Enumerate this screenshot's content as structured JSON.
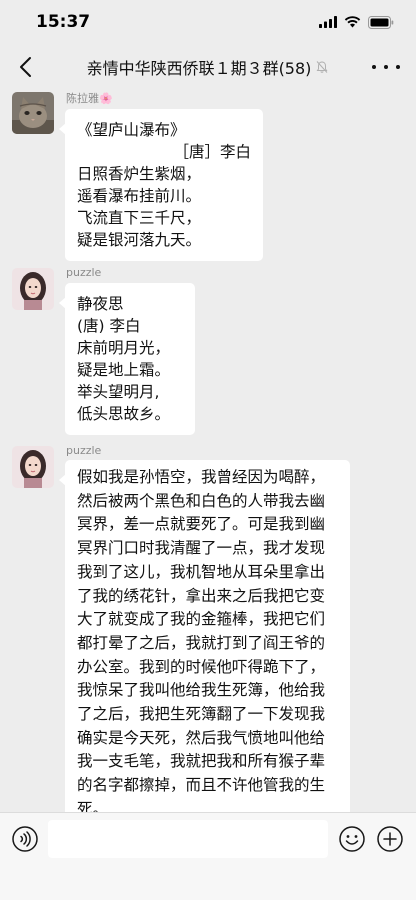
{
  "status_bar": {
    "time": "15:37"
  },
  "header": {
    "title": "亲情中华陕西侨联１期３群(58)"
  },
  "messages": [
    {
      "sender": "陈拉雅🌸",
      "lines": [
        "《望庐山瀑布》",
        "［唐］李白",
        "日照香炉生紫烟，",
        "遥看瀑布挂前川。",
        "飞流直下三千尺，",
        "疑是银河落九天。"
      ]
    },
    {
      "sender": "puzzle",
      "lines": [
        "静夜思",
        "(唐) 李白",
        "床前明月光，",
        "疑是地上霜。",
        "举头望明月,",
        "低头思故乡。"
      ]
    },
    {
      "sender": "puzzle",
      "text": "假如我是孙悟空，我曾经因为喝醉，然后被两个黑色和白色的人带我去幽冥界，差一点就要死了。可是我到幽冥界门口时我清醒了一点，我才发现我到了这儿，我机智地从耳朵里拿出了我的绣花针，拿出来之后我把它变大了就变成了我的金箍棒，我把它们都打晕了之后，我就打到了阎王爷的办公室。我到的时候他吓得跪下了，我惊呆了我叫他给我生死簿，他给我了之后，我把生死簿翻了一下发现我确实是今天死，然后我气愤地叫他给我一支毛笔，我就把我和所有猴子辈的名字都擦掉，而且不许他管我的生死。"
    }
  ],
  "icons": {
    "back": "chevron-left-icon",
    "more": "more-icon",
    "mute": "mute-bell-icon",
    "voice": "voice-icon",
    "emoji": "emoji-icon",
    "add": "add-icon"
  }
}
